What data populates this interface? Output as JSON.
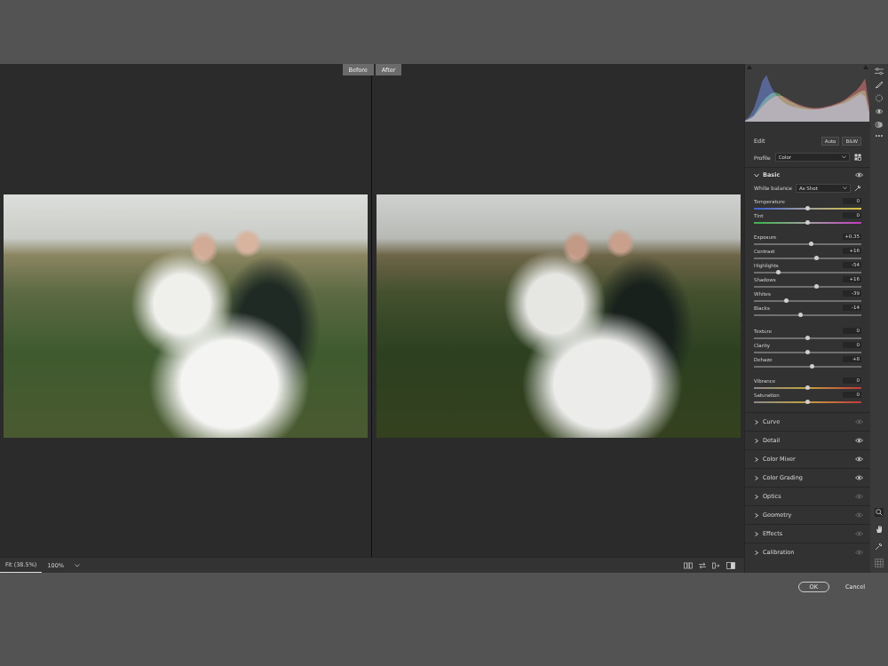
{
  "view": {
    "labels": [
      "Before",
      "After"
    ]
  },
  "histogram": {
    "series": [
      {
        "name": "red",
        "color": "#d94a4a",
        "values": [
          0.02,
          0.05,
          0.1,
          0.2,
          0.3,
          0.38,
          0.45,
          0.5,
          0.52,
          0.5,
          0.45,
          0.4,
          0.36,
          0.33,
          0.3,
          0.28,
          0.27,
          0.27,
          0.28,
          0.3,
          0.32,
          0.35,
          0.38,
          0.42,
          0.48,
          0.55,
          0.62,
          0.72,
          0.85,
          0.3
        ]
      },
      {
        "name": "green",
        "color": "#4fae5a",
        "values": [
          0.02,
          0.06,
          0.12,
          0.25,
          0.38,
          0.48,
          0.55,
          0.58,
          0.55,
          0.48,
          0.42,
          0.38,
          0.34,
          0.3,
          0.28,
          0.26,
          0.25,
          0.25,
          0.26,
          0.28,
          0.3,
          0.33,
          0.36,
          0.4,
          0.45,
          0.5,
          0.55,
          0.6,
          0.62,
          0.2
        ]
      },
      {
        "name": "blue",
        "color": "#3f63d6",
        "values": [
          0.03,
          0.1,
          0.25,
          0.5,
          0.8,
          0.92,
          0.7,
          0.55,
          0.45,
          0.38,
          0.33,
          0.3,
          0.28,
          0.26,
          0.25,
          0.24,
          0.24,
          0.25,
          0.26,
          0.28,
          0.3,
          0.32,
          0.34,
          0.36,
          0.4,
          0.45,
          0.5,
          0.55,
          0.5,
          0.15
        ]
      }
    ]
  },
  "edit": {
    "title": "Edit",
    "buttons": [
      "Auto",
      "B&W"
    ]
  },
  "profile": {
    "label": "Profile",
    "value": "Color"
  },
  "basic": {
    "title": "Basic",
    "expanded": true,
    "visible": true,
    "white_balance": {
      "label": "White balance",
      "value": "As Shot"
    },
    "groups": [
      [
        {
          "label": "Temperature",
          "value": "0",
          "level": 0.5,
          "kind": "temperature"
        },
        {
          "label": "Tint",
          "value": "0",
          "level": 0.5,
          "kind": "tint"
        }
      ],
      [
        {
          "label": "Exposure",
          "value": "+0.35",
          "level": 0.535,
          "kind": "plain"
        },
        {
          "label": "Contrast",
          "value": "+16",
          "level": 0.58,
          "kind": "plain"
        },
        {
          "label": "Highlights",
          "value": "-54",
          "level": 0.23,
          "kind": "plain"
        },
        {
          "label": "Shadows",
          "value": "+16",
          "level": 0.58,
          "kind": "plain"
        },
        {
          "label": "Whites",
          "value": "-39",
          "level": 0.305,
          "kind": "plain"
        },
        {
          "label": "Blacks",
          "value": "-14",
          "level": 0.43,
          "kind": "plain"
        }
      ],
      [
        {
          "label": "Texture",
          "value": "0",
          "level": 0.5,
          "kind": "plain"
        },
        {
          "label": "Clarity",
          "value": "0",
          "level": 0.5,
          "kind": "plain"
        },
        {
          "label": "Dehaze",
          "value": "+8",
          "level": 0.54,
          "kind": "plain"
        }
      ],
      [
        {
          "label": "Vibrance",
          "value": "0",
          "level": 0.5,
          "kind": "saturation"
        },
        {
          "label": "Saturation",
          "value": "0",
          "level": 0.5,
          "kind": "saturation"
        }
      ]
    ]
  },
  "sections": [
    {
      "title": "Curve",
      "expanded": false,
      "visible": false
    },
    {
      "title": "Detail",
      "expanded": false,
      "visible": true
    },
    {
      "title": "Color Mixer",
      "expanded": false,
      "visible": true
    },
    {
      "title": "Color Grading",
      "expanded": false,
      "visible": true
    },
    {
      "title": "Optics",
      "expanded": false,
      "visible": false
    },
    {
      "title": "Geometry",
      "expanded": false,
      "visible": false
    },
    {
      "title": "Effects",
      "expanded": false,
      "visible": false
    },
    {
      "title": "Calibration",
      "expanded": false,
      "visible": false
    }
  ],
  "zoom": {
    "options": [
      {
        "label": "Fit (38.5%)",
        "selected": true
      },
      {
        "label": "100%",
        "selected": false
      }
    ]
  },
  "buttons": [
    {
      "label": "OK",
      "kind": "primary"
    },
    {
      "label": "Cancel",
      "kind": "plain"
    }
  ]
}
